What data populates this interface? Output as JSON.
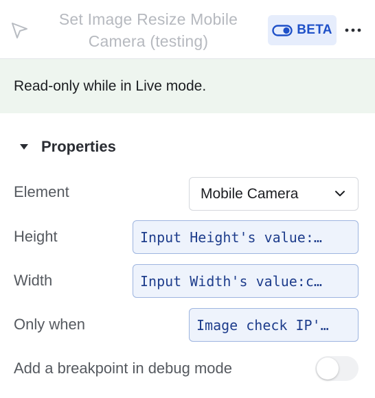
{
  "header": {
    "title": "Set Image Resize Mobile Camera (testing)",
    "badge_label": "BETA",
    "icons": {
      "cursor": "cursor-pointer-icon",
      "toggle": "toggle-icon",
      "more": "more-dots-icon"
    }
  },
  "notice": {
    "text": "Read-only while in Live mode."
  },
  "properties": {
    "title": "Properties",
    "expanded": true,
    "rows": [
      {
        "label": "Element",
        "value": "Mobile Camera",
        "kind": "select"
      },
      {
        "label": "Height",
        "value": "Input Height's value:…",
        "kind": "expression"
      },
      {
        "label": "Width",
        "value": "Input Width's value:c…",
        "kind": "expression"
      },
      {
        "label": "Only when",
        "value": "Image check IP'…",
        "kind": "expression"
      }
    ],
    "breakpoint": {
      "label": "Add a breakpoint in debug mode",
      "enabled": false
    }
  },
  "colors": {
    "accent": "#1e50c8",
    "badge_bg": "#e6edfc",
    "notice_bg": "#eef5ef",
    "expression_bg": "#eef3fc",
    "expression_border": "#9db4df"
  }
}
